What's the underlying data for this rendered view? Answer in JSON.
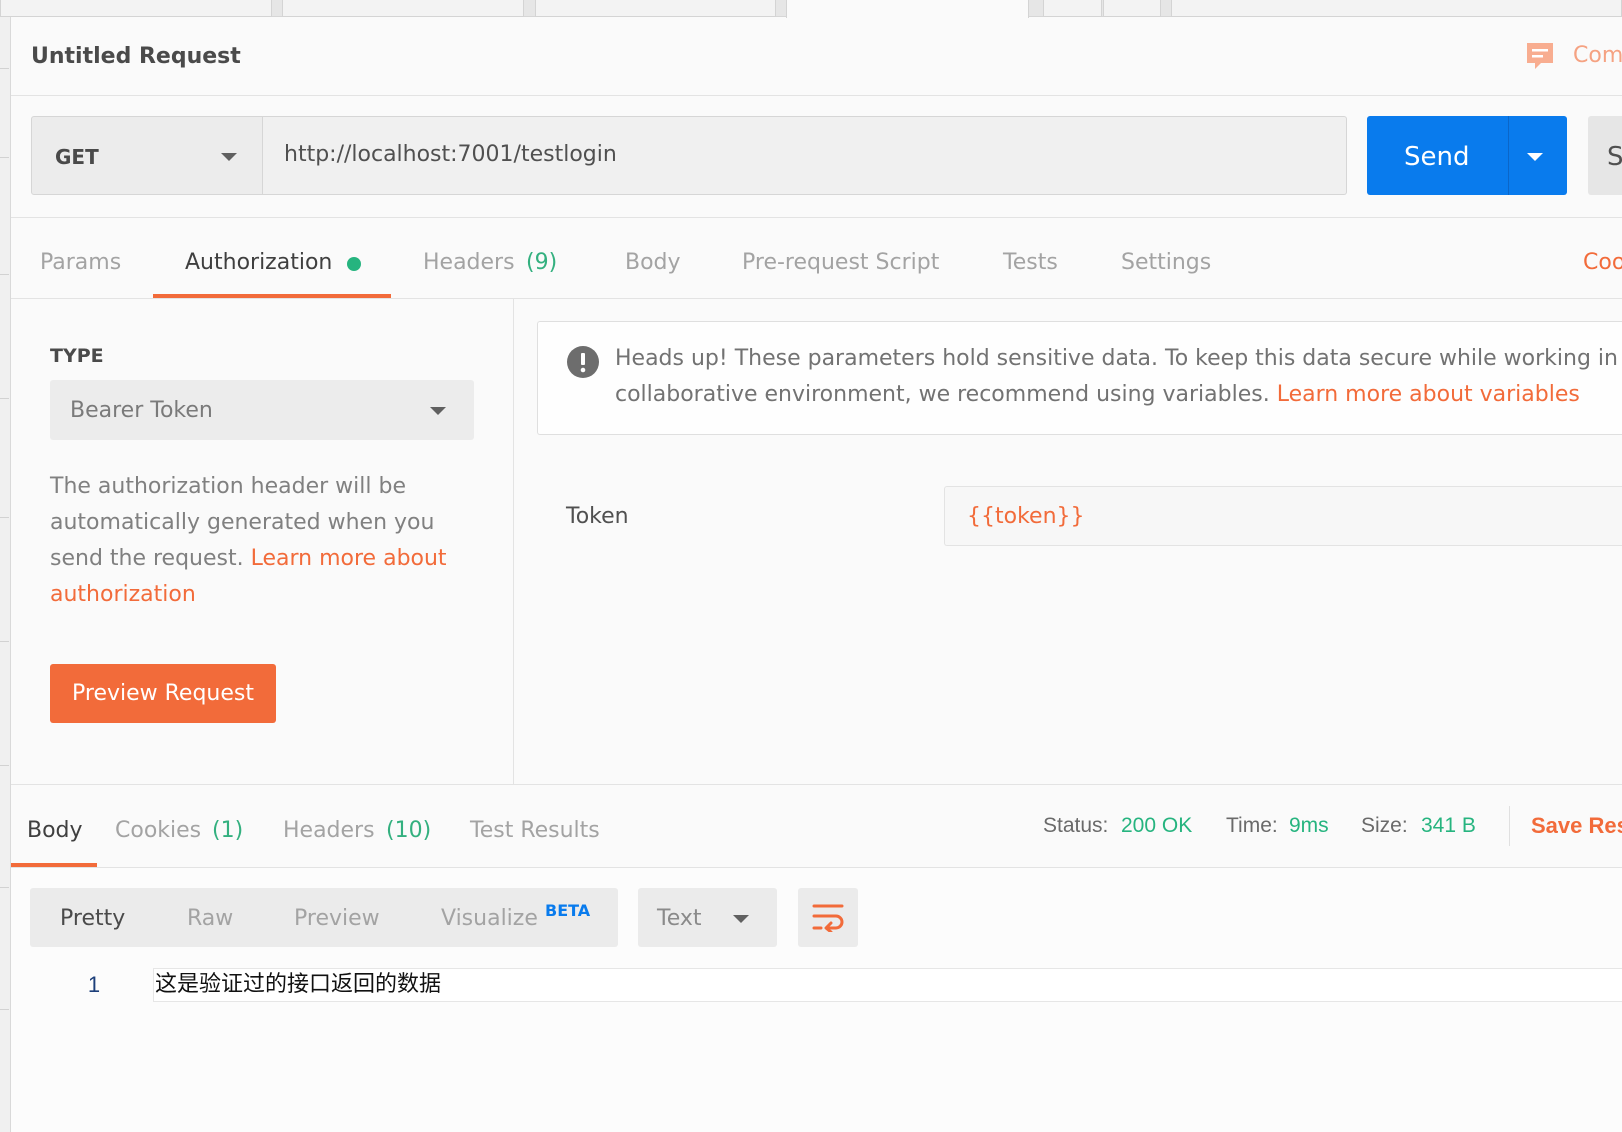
{
  "request": {
    "title": "Untitled Request",
    "comments_label": "Com",
    "method": "GET",
    "url": "http://localhost:7001/testlogin",
    "send_label": "Send",
    "save_label": "S"
  },
  "request_tabs": [
    {
      "label": "Params"
    },
    {
      "label": "Authorization",
      "active": true
    },
    {
      "label": "Headers",
      "count": "(9)"
    },
    {
      "label": "Body"
    },
    {
      "label": "Pre-request Script"
    },
    {
      "label": "Tests"
    },
    {
      "label": "Settings"
    }
  ],
  "code_label": "Coo",
  "auth": {
    "type_label": "TYPE",
    "type_value": "Bearer Token",
    "description": "The authorization header will be automatically generated when you send the request.",
    "learn_more": "Learn more about authorization",
    "preview_button": "Preview Request",
    "warning": {
      "line1": "Heads up! These parameters hold sensitive data. To keep this data secure while working in",
      "line2": "collaborative environment, we recommend using variables.",
      "link": "Learn more about variables"
    },
    "token_label": "Token",
    "token_value": "{{token}}"
  },
  "response": {
    "tabs": [
      {
        "label": "Body",
        "active": true
      },
      {
        "label": "Cookies",
        "count": "(1)"
      },
      {
        "label": "Headers",
        "count": "(10)"
      },
      {
        "label": "Test Results"
      }
    ],
    "status": {
      "label": "Status:",
      "value": "200 OK"
    },
    "time": {
      "label": "Time:",
      "value": "9ms"
    },
    "size": {
      "label": "Size:",
      "value": "341 B"
    },
    "save_label": "Save Res",
    "view_modes": [
      {
        "label": "Pretty",
        "active": true
      },
      {
        "label": "Raw"
      },
      {
        "label": "Preview"
      },
      {
        "label": "Visualize",
        "badge": "BETA"
      }
    ],
    "format": "Text",
    "lines": [
      {
        "number": "1",
        "text": "这是验证过的接口返回的数据"
      }
    ]
  },
  "colors": {
    "accent": "#f26b3a",
    "send_button": "#097bed",
    "success": "#26b47f",
    "beta_badge": "#097bed"
  },
  "icons": [
    "comment-icon",
    "chevron-down-icon",
    "status-dot-icon",
    "warning-icon",
    "wrap-lines-icon"
  ]
}
